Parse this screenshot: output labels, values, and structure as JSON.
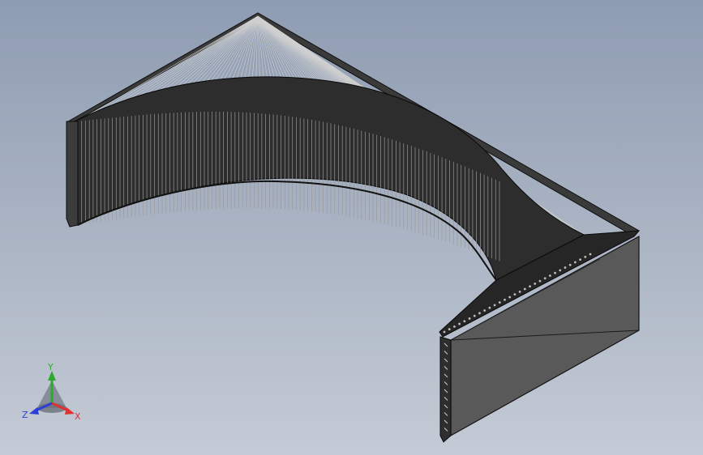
{
  "viewport": {
    "background_top": "#8e9cb2",
    "background_bottom": "#c4cbd6"
  },
  "model": {
    "name": "",
    "face_color": "#5a5a5a",
    "edge_color": "#1a1a1a",
    "highlight_color": "#d8d8d8"
  },
  "triad": {
    "x_label": "X",
    "y_label": "Y",
    "z_label": "Z",
    "x_color": "#e03030",
    "y_color": "#2ea82e",
    "z_color": "#2b3fd6"
  }
}
